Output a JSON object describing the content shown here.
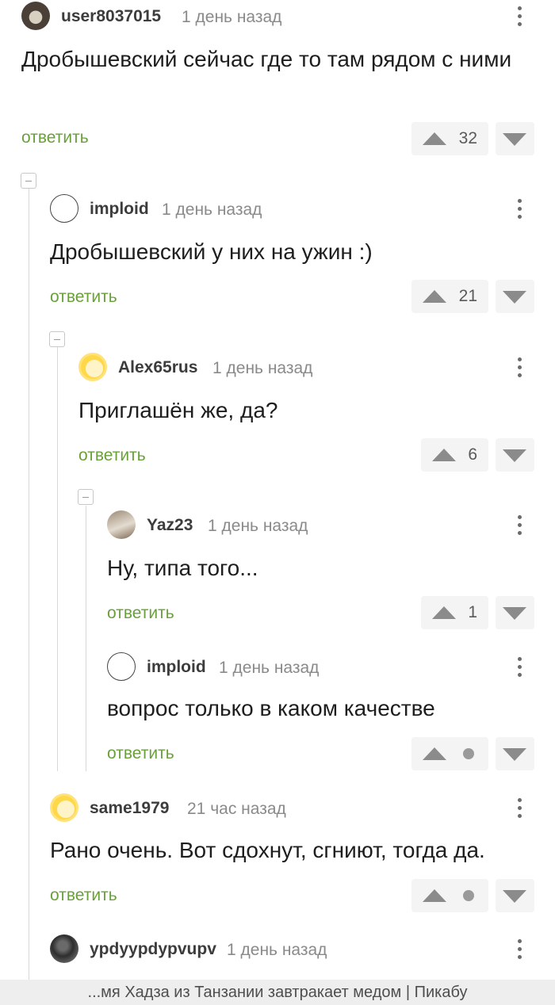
{
  "comments": [
    {
      "username": "user8037015",
      "time": "1 день назад",
      "text": "Дробышевский сейчас где то там рядом с ними",
      "reply": "ответить",
      "votes": "32"
    },
    {
      "username": "imploid",
      "time": "1 день назад",
      "text": "Дробышевский у них на ужин :)",
      "reply": "ответить",
      "votes": "21"
    },
    {
      "username": "Alex65rus",
      "time": "1 день назад",
      "text": "Приглашён же, да?",
      "reply": "ответить",
      "votes": "6"
    },
    {
      "username": "Yaz23",
      "time": "1 день назад",
      "text": "Ну, типа того...",
      "reply": "ответить",
      "votes": "1"
    },
    {
      "username": "imploid",
      "time": "1 день назад",
      "text": "вопрос только в каком качестве",
      "reply": "ответить",
      "votes": ""
    },
    {
      "username": "same1979",
      "time": "21 час назад",
      "text": "Рано очень. Вот сдохнут, сгниют, тогда да.",
      "reply": "ответить",
      "votes": ""
    },
    {
      "username": "ypdyypdypvupv",
      "time": "1 день назад"
    }
  ],
  "footer": {
    "text": "...мя Хадза из Танзании завтракает медом | Пикабу"
  },
  "colors": {
    "reply": "#6aa03a",
    "time": "#8a8a8a",
    "footer_bg": "#eeeeee"
  },
  "icons": [
    "avatar",
    "vertical-dots-menu-icon",
    "upvote-arrow-icon",
    "downvote-arrow-icon",
    "collapse-minus-icon"
  ]
}
